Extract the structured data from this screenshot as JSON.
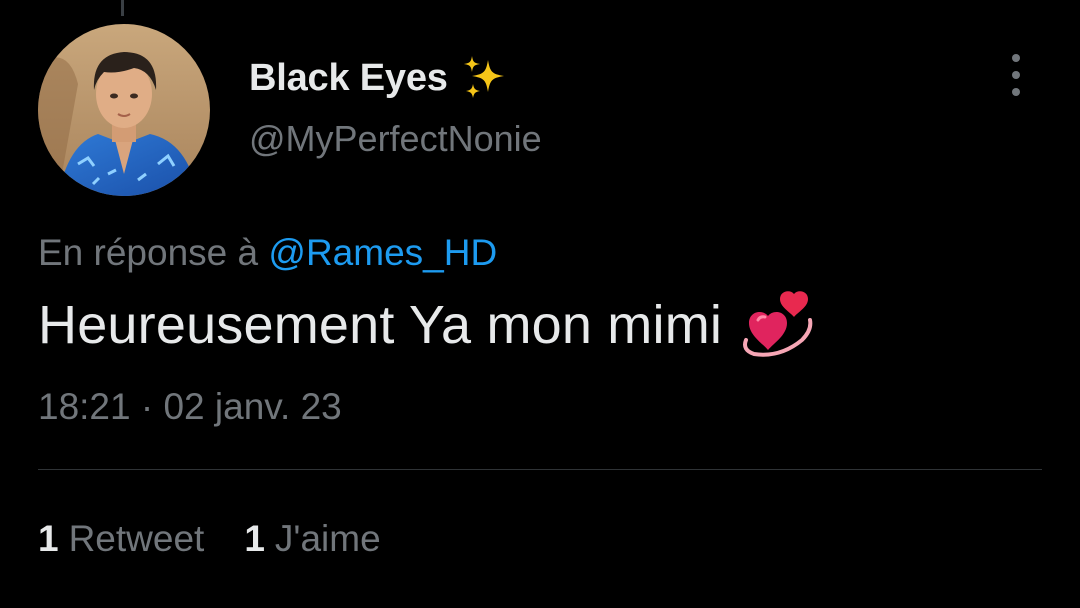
{
  "tweet": {
    "author": {
      "display_name": "Black Eyes",
      "name_emoji_icon": "sparkles-icon",
      "handle": "@MyPerfectNonie"
    },
    "more_icon": "vertical-ellipsis-icon",
    "reply_context": {
      "prefix": "En réponse à",
      "mention": "@Rames_HD"
    },
    "text": "Heureusement Ya mon mimi",
    "text_emoji_icon": "two-hearts-icon",
    "timestamp": "18:21 · 02 janv. 23",
    "stats": {
      "retweets": {
        "count": "1",
        "label": "Retweet"
      },
      "likes": {
        "count": "1",
        "label": "J'aime"
      }
    }
  },
  "colors": {
    "background": "#000000",
    "primary_text": "#e7e9ea",
    "secondary_text": "#71767b",
    "link": "#1d9bf0",
    "divider": "#2f3336",
    "sparkle": "#f5c518",
    "heart": "#e0245e"
  }
}
